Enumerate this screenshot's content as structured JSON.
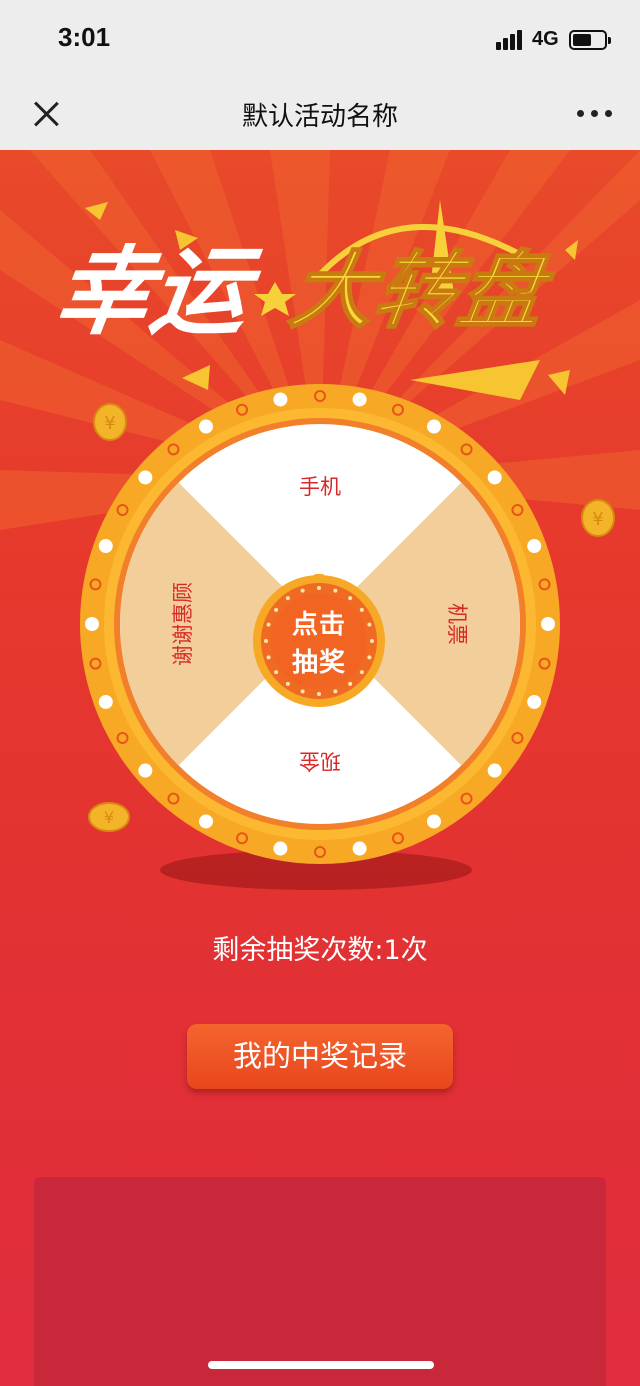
{
  "status_bar": {
    "time": "3:01",
    "network": "4G"
  },
  "nav": {
    "title": "默认活动名称"
  },
  "banner": {
    "title_part1": "幸运",
    "title_part2": "大转盘"
  },
  "wheel": {
    "prizes": [
      "手机",
      "机票",
      "现金",
      "谢谢惠顾"
    ],
    "center_line1": "点击",
    "center_line2": "抽奖"
  },
  "remaining_text": "剩余抽奖次数:1次",
  "record_button": "我的中奖记录",
  "colors": {
    "background_top": "#e84a2a",
    "background_bottom": "#e02c3e",
    "wheel_rim": "#f6a623",
    "segment_white": "#ffffff",
    "segment_tan": "#f2ce9a",
    "prize_text": "#d62a2a",
    "button": "#ee5424"
  }
}
